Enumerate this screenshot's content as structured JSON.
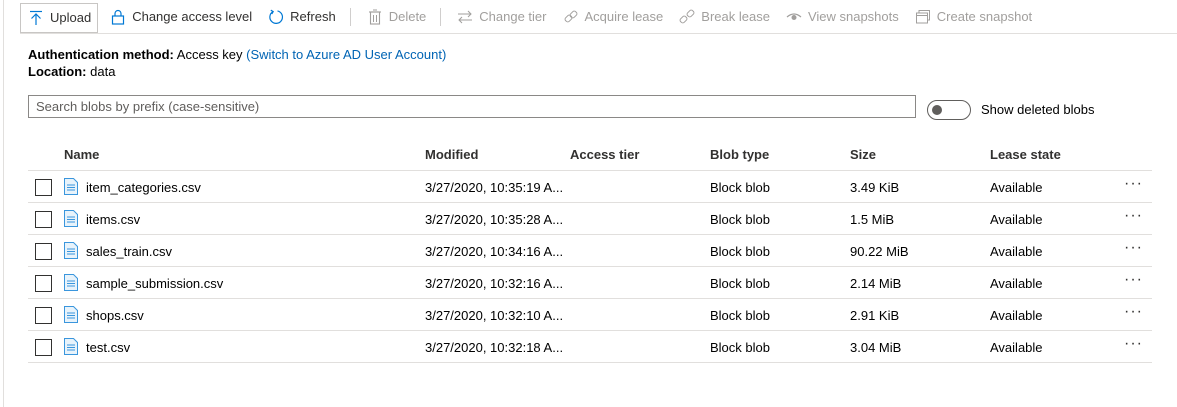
{
  "toolbar": {
    "upload": "Upload",
    "change_access": "Change access level",
    "refresh": "Refresh",
    "delete": "Delete",
    "change_tier": "Change tier",
    "acquire_lease": "Acquire lease",
    "break_lease": "Break lease",
    "view_snapshots": "View snapshots",
    "create_snapshot": "Create snapshot"
  },
  "info": {
    "auth_label": "Authentication method:",
    "auth_value": "Access key",
    "auth_link": "(Switch to Azure AD User Account)",
    "location_label": "Location:",
    "location_value": "data"
  },
  "search": {
    "placeholder": "Search blobs by prefix (case-sensitive)",
    "value": ""
  },
  "toggle": {
    "label": "Show deleted blobs",
    "on": false
  },
  "table": {
    "columns": {
      "name": "Name",
      "modified": "Modified",
      "tier": "Access tier",
      "type": "Blob type",
      "size": "Size",
      "lease": "Lease state"
    },
    "rows": [
      {
        "name": "item_categories.csv",
        "modified": "3/27/2020, 10:35:19 A...",
        "tier": "",
        "type": "Block blob",
        "size": "3.49 KiB",
        "lease": "Available",
        "more": "···"
      },
      {
        "name": "items.csv",
        "modified": "3/27/2020, 10:35:28 A...",
        "tier": "",
        "type": "Block blob",
        "size": "1.5 MiB",
        "lease": "Available",
        "more": "···"
      },
      {
        "name": "sales_train.csv",
        "modified": "3/27/2020, 10:34:16 A...",
        "tier": "",
        "type": "Block blob",
        "size": "90.22 MiB",
        "lease": "Available",
        "more": "···"
      },
      {
        "name": "sample_submission.csv",
        "modified": "3/27/2020, 10:32:16 A...",
        "tier": "",
        "type": "Block blob",
        "size": "2.14 MiB",
        "lease": "Available",
        "more": "···"
      },
      {
        "name": "shops.csv",
        "modified": "3/27/2020, 10:32:10 A...",
        "tier": "",
        "type": "Block blob",
        "size": "2.91 KiB",
        "lease": "Available",
        "more": "···"
      },
      {
        "name": "test.csv",
        "modified": "3/27/2020, 10:32:18 A...",
        "tier": "",
        "type": "Block blob",
        "size": "3.04 MiB",
        "lease": "Available",
        "more": "···"
      }
    ]
  },
  "colors": {
    "accent": "#0078d4",
    "link": "#0064b4",
    "disabled": "#a19f9d",
    "file_icon": "#3a96dd"
  }
}
